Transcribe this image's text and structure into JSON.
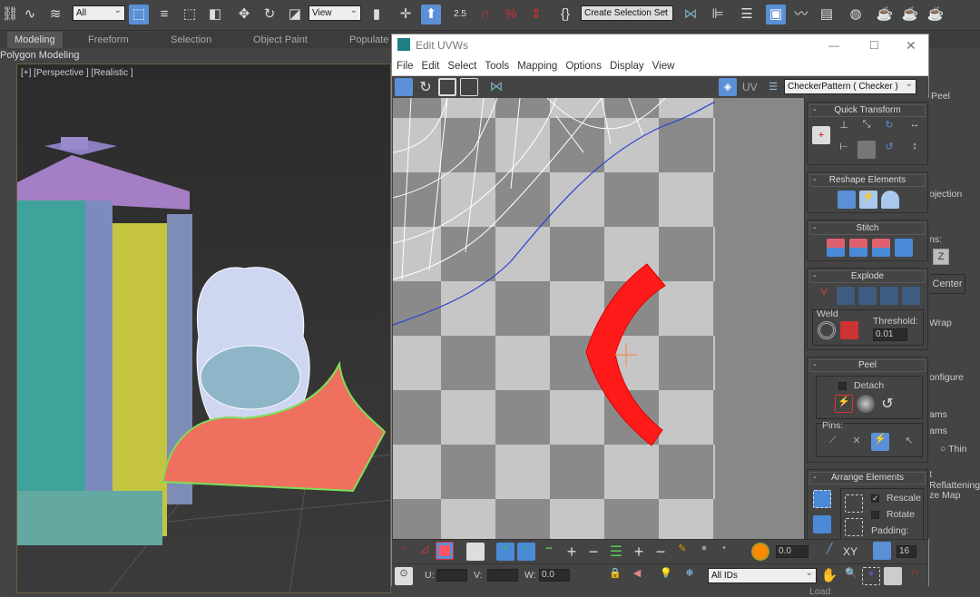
{
  "main_toolbar": {
    "filter_select": "All",
    "refcoord_select": "View",
    "snap_angle": "2.5",
    "selection_set_placeholder": "Create Selection Set",
    "icons": [
      "link-icon",
      "unlink-icon",
      "bind-space-warp-icon",
      "select-object-icon",
      "select-by-name-icon",
      "rect-region-icon",
      "window-crossing-icon",
      "move-icon",
      "rotate-icon",
      "scale-icon",
      "pivot-icon",
      "select-manipulate-icon",
      "keyboard-shortcut-icon",
      "snap-icon",
      "angle-snap-icon",
      "percent-snap-icon",
      "spinner-snap-icon",
      "edit-named-sets-icon",
      "mirror-icon",
      "align-icon",
      "layer-icon",
      "scene-explorer-icon",
      "curve-editor-icon",
      "schematic-view-icon",
      "material-editor-icon",
      "render-setup-icon",
      "rendered-frame-icon",
      "render-icon"
    ]
  },
  "ribbon": {
    "tabs": [
      "Modeling",
      "Freeform",
      "Selection",
      "Object Paint",
      "Populate"
    ],
    "active": "Modeling",
    "subpanel": "Polygon Modeling"
  },
  "viewport": {
    "label": "[+] [Perspective ] [Realistic ]"
  },
  "uv_editor": {
    "title": "Edit UVWs",
    "window_controls": [
      "minimize",
      "maximize",
      "close"
    ],
    "menu": [
      "File",
      "Edit",
      "Select",
      "Tools",
      "Mapping",
      "Options",
      "Display",
      "View"
    ],
    "uv_label": "UV",
    "texture_select": "CheckerPattern  ( Checker )",
    "rollouts": {
      "quick_transform": "Quick Transform",
      "reshape": "Reshape Elements",
      "stitch": "Stitch",
      "explode": "Explode",
      "weld": "Weld",
      "threshold_label": "Threshold:",
      "threshold_value": "0.01",
      "peel": "Peel",
      "detach_label": "Detach",
      "detach_checked": false,
      "pins_label": "Pins:",
      "arrange": "Arrange Elements",
      "rescale_label": "Rescale",
      "rescale_checked": true,
      "rotate_label": "Rotate",
      "rotate_checked": false,
      "padding_label": "Padding:"
    },
    "bottom": {
      "rotate_value": "0.0",
      "xy_label": "XY",
      "grid_value": "16",
      "u_label": "U:",
      "v_label": "V:",
      "w_label": "W:",
      "w_value": "0.0",
      "id_select": "All IDs"
    },
    "colors": {
      "selection": "#ff0000",
      "accent": "#5b8fd6"
    }
  },
  "command_panel": {
    "peel": "Peel",
    "projection": "ojection",
    "axis_label": "ns:",
    "z_button": "Z",
    "center_button": "Center",
    "wrap": "Wrap",
    "configure": "onfigure",
    "seams1": "ams",
    "seams2": "ams",
    "thin_label": "Thin",
    "reflattening": "t Reflattening",
    "map_label": "ze Map",
    "load_label": "Load"
  }
}
